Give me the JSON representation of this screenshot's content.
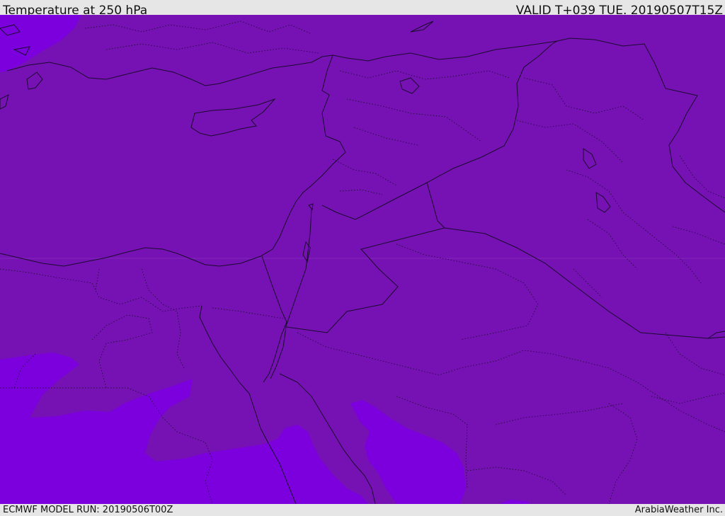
{
  "header": {
    "title": "Temperature at 250 hPa",
    "valid": "VALID T+039 TUE. 20190507T15Z"
  },
  "footer": {
    "model_run": "ECMWF MODEL RUN: 20190506T00Z",
    "credit": "ArabiaWeather Inc."
  },
  "colors": {
    "field_main": "#7612b3",
    "field_cold": "#7c00dd",
    "coastline": "#1a0a2e",
    "header_bg": "#e6e6e6"
  }
}
